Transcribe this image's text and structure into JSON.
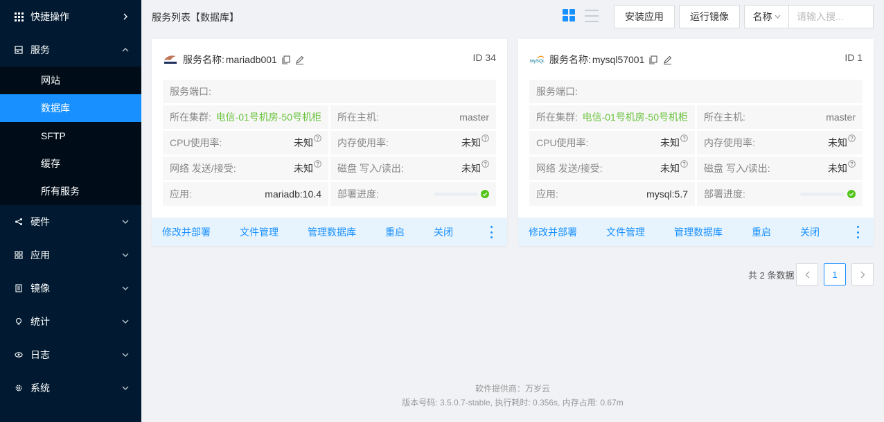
{
  "sidebar": {
    "quick": "快捷操作",
    "service": "服务",
    "sub": [
      "网站",
      "数据库",
      "SFTP",
      "缓存",
      "所有服务"
    ],
    "items": [
      "硬件",
      "应用",
      "镜像",
      "统计",
      "日志",
      "系统"
    ]
  },
  "header": {
    "title": "服务列表【数据库】",
    "install": "安装应用",
    "run": "运行镜像",
    "search_field": "名称",
    "search_placeholder": "请输入搜..."
  },
  "labels": {
    "name": "服务名称:",
    "port": "服务端口:",
    "cluster": "所在集群:",
    "host": "所在主机:",
    "cpu": "CPU使用率:",
    "mem": "内存使用率:",
    "net": "网络 发送/接受:",
    "disk": "磁盘 写入/读出:",
    "app": "应用:",
    "progress": "部署进度:"
  },
  "cards": [
    {
      "name": "mariadb001",
      "id": "ID 34",
      "port": "",
      "cluster": "电信-01号机房-50号机柜",
      "host": "master",
      "cpu": "未知",
      "mem": "未知",
      "net": "未知",
      "disk": "未知",
      "app": "mariadb:10.4",
      "progress": 100,
      "logo": "mariadb-logo-icon"
    },
    {
      "name": "mysql57001",
      "id": "ID 1",
      "port": "",
      "cluster": "电信-01号机房-50号机柜",
      "host": "master",
      "cpu": "未知",
      "mem": "未知",
      "net": "未知",
      "disk": "未知",
      "app": "mysql:5.7",
      "progress": 100,
      "logo": "mysql-logo-icon"
    }
  ],
  "actions": [
    "修改并部署",
    "文件管理",
    "管理数据库",
    "重启",
    "关闭"
  ],
  "pagination": {
    "total": "共 2 条数据",
    "current": "1"
  },
  "footer": {
    "provider": "软件提供商：万岁云",
    "version": "版本号码: 3.5.0.7-stable,   执行耗时: 0.356s,   内存占用: 0.67m"
  },
  "colors": {
    "sidebar": "#011a31",
    "active": "#1890ff",
    "success": "#52c41a",
    "cluster_text": "#67c23a"
  }
}
